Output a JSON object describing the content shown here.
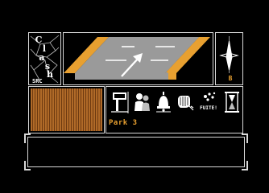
{
  "game": {
    "logo_text": "Clash",
    "logo_letters": [
      "C",
      "l",
      "a",
      "s",
      "h"
    ],
    "logo_sub": "SRC"
  },
  "compass": {
    "direction_letter": "B"
  },
  "location": {
    "name": "Park 3"
  },
  "actions": [
    {
      "id": "sign",
      "icon": "signpost-icon"
    },
    {
      "id": "people",
      "icon": "people-icon"
    },
    {
      "id": "bell",
      "icon": "bell-icon"
    },
    {
      "id": "hand",
      "icon": "hand-icon"
    },
    {
      "id": "flee",
      "icon": "flee-icon",
      "label": "FUITE!"
    },
    {
      "id": "hourglass",
      "icon": "hourglass-icon"
    }
  ],
  "colors": {
    "background": "#000000",
    "frame": "#d8d8d8",
    "accent_orange": "#e8a030",
    "road_gray": "#9a9a9a",
    "wood": "#b06a28"
  }
}
